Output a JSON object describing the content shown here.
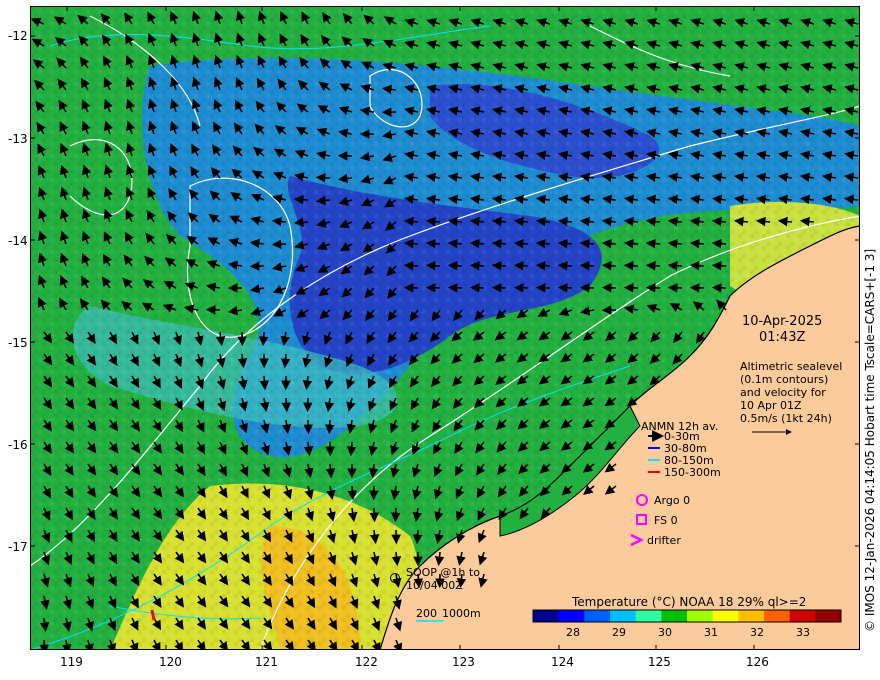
{
  "map": {
    "lat_ticks": [
      "-12",
      "-13",
      "-14",
      "-15",
      "-16",
      "-17"
    ],
    "lon_ticks": [
      "119",
      "120",
      "121",
      "122",
      "123",
      "124",
      "125",
      "126"
    ]
  },
  "side_label": "© IMOS 12-Jan-2026 04:14:05 Hobart time Tscale=CARS+[-1 3]",
  "timestamp": {
    "date": "10-Apr-2025",
    "time": "01:43Z"
  },
  "altimetry_note": [
    "Altimetric sealevel",
    "(0.1m contours)",
    "and velocity for",
    "10 Apr 01Z",
    "0.5m/s (1kt 24h)"
  ],
  "anmn": {
    "title": "ANMN 12h av.",
    "depths": [
      {
        "label": "0-30m",
        "color": "#000000"
      },
      {
        "label": "30-80m",
        "color": "#0000ff"
      },
      {
        "label": "80-150m",
        "color": "#00e5ff"
      },
      {
        "label": "150-300m",
        "color": "#ff0000"
      }
    ]
  },
  "markers": {
    "argo": "Argo 0",
    "fs": "FS 0",
    "drifter": "drifter"
  },
  "soop": [
    "SOOP @1h to",
    "10/04 00Z"
  ],
  "bathy": {
    "label1": "200",
    "label2": "1000m"
  },
  "colorbar": {
    "title": "Temperature (°C) NOAA 18 29% ql>=2",
    "ticks": [
      "28",
      "29",
      "30",
      "31",
      "32",
      "33"
    ],
    "colors": [
      "#00008f",
      "#0000ff",
      "#0060ff",
      "#00bfff",
      "#30ff9f",
      "#00c000",
      "#9fff00",
      "#ffff00",
      "#ffbf00",
      "#ff6000",
      "#d00000",
      "#8f0000"
    ]
  },
  "colors": {
    "land": "#fbcb9b",
    "coast": "#000000",
    "contour": "#ffffff",
    "bathy": "#00e5ff",
    "marker": "#ff00ff"
  }
}
